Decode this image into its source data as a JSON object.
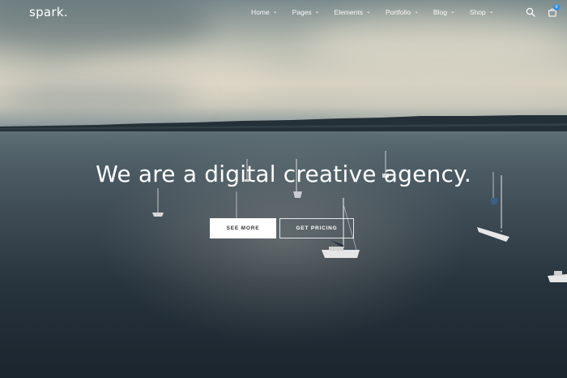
{
  "nav": {
    "logo": "spark.",
    "items": [
      {
        "label": "Home"
      },
      {
        "label": "Pages"
      },
      {
        "label": "Elements"
      },
      {
        "label": "Portfolio"
      },
      {
        "label": "Blog"
      },
      {
        "label": "Shop"
      }
    ],
    "cart_count": "0"
  },
  "hero": {
    "headline": "We are a digital creative agency.",
    "primary_button": "SEE MORE",
    "secondary_button": "GET PRICING"
  },
  "icons": {
    "search": "search-icon",
    "cart": "shopping-bag-icon",
    "chevron": "chevron-down-icon"
  },
  "colors": {
    "accent": "#2f8fe3",
    "text": "#ffffff"
  }
}
